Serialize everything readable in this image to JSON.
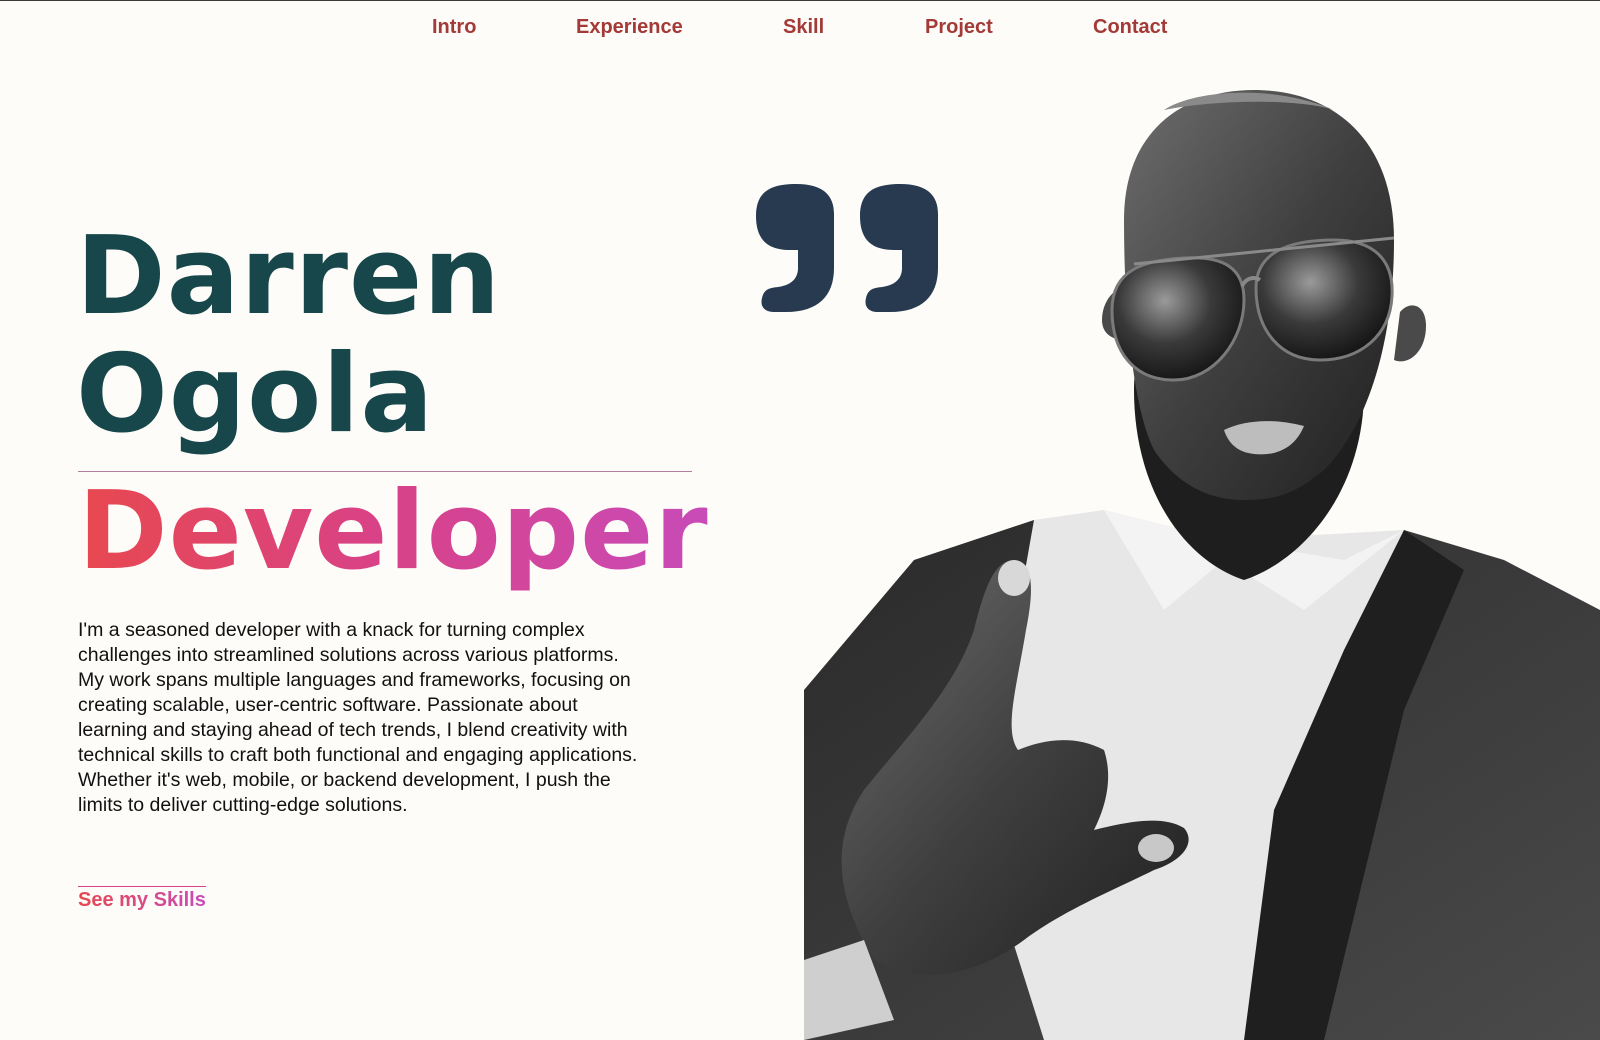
{
  "nav": {
    "items": [
      {
        "label": "Intro"
      },
      {
        "label": "Experience"
      },
      {
        "label": "Skill"
      },
      {
        "label": "Project"
      },
      {
        "label": "Contact"
      }
    ]
  },
  "hero": {
    "first_name": "Darren",
    "last_name": "Ogola",
    "role": "Developer",
    "bio": "I'm a seasoned developer with a knack for turning complex challenges into streamlined solutions across various platforms. My work spans multiple languages and frameworks, focusing on creating scalable, user-centric software. Passionate about learning and staying ahead of tech trends, I blend creativity with technical skills to craft both functional and engaging applications. Whether it's web, mobile, or backend development, I push the limits to deliver cutting-edge solutions.",
    "cta_label": "See my Skills"
  },
  "decor": {
    "quote_icon": "closing-quote-icon",
    "photo": "portrait-photo"
  },
  "colors": {
    "background": "#fdfcf9",
    "nav_text": "#a33a37",
    "name_text": "#17474a",
    "gradient_start": "#e8484f",
    "gradient_end": "#c84bb8",
    "quote_mark": "#273a50"
  }
}
